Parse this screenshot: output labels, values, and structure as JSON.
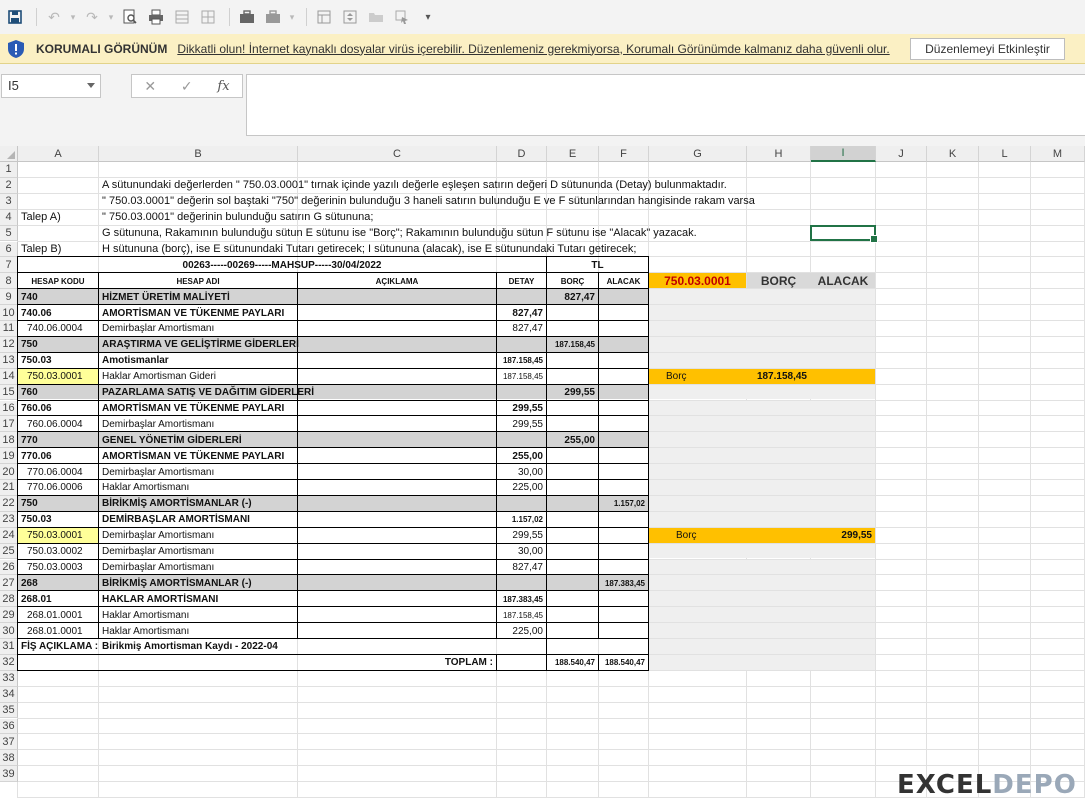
{
  "toolbar": {
    "icons": [
      "save-icon",
      "undo-icon",
      "redo-icon",
      "print-preview-icon",
      "print-icon",
      "sheet-icon",
      "sheet2-icon",
      "briefcase-icon",
      "briefcase2-icon",
      "table-icon",
      "sort-icon",
      "folder-icon",
      "cursor-icon",
      "customize-icon"
    ]
  },
  "protected_view": {
    "title": "KORUMALI GÖRÜNÜM",
    "message": "Dikkatli olun! İnternet kaynaklı dosyalar virüs içerebilir. Düzenlemeniz gerekmiyorsa, Korumalı Görünümde kalmanız daha güvenli olur.",
    "button": "Düzenlemeyi Etkinleştir",
    "bar_color": "#fbf0c4"
  },
  "formula_bar": {
    "name_box": "I5",
    "cancel": "✕",
    "enter": "✓",
    "fx": "fx",
    "value": ""
  },
  "columns": [
    "A",
    "B",
    "C",
    "D",
    "E",
    "F",
    "G",
    "H",
    "I",
    "J",
    "K",
    "L",
    "M"
  ],
  "rows": [
    "1",
    "2",
    "3",
    "4",
    "5",
    "6",
    "7",
    "8",
    "9",
    "10",
    "11",
    "12",
    "13",
    "14",
    "15",
    "16",
    "17",
    "18",
    "19",
    "20",
    "21",
    "22",
    "23",
    "24",
    "25",
    "26",
    "27",
    "28",
    "29",
    "30",
    "31",
    "32",
    "33",
    "34",
    "35",
    "36",
    "37",
    "38",
    "39"
  ],
  "notes": {
    "r2": "A sütunundaki değerlerden \"   750.03.0001\" tırnak içinde yazılı değerle eşleşen satırın değeri  D sütununda (Detay) bulunmaktadır.",
    "r3": "\"   750.03.0001\" değerin sol baştaki \"750\" değerinin bulunduğu 3 haneli satırın bulunduğu E ve F sütunlarından hangisinde rakam varsa",
    "r4a": "Talep A)",
    "r4b": "\"   750.03.0001\"  değerinin bulunduğu satırın G sütununa;",
    "r5": "G sütununa, Rakamının bulunduğu sütun E sütunu ise \"Borç\"; Rakamının bulunduğu sütun F sütunu ise \"Alacak\" yazacak.",
    "r6a": "Talep B)",
    "r6b": "H sütununa (borç), ise E sütunundaki Tutarı getirecek; I sütununa (alacak), ise E sütunundaki Tutarı getirecek;"
  },
  "voucher": {
    "header": "00263-----00269-----MAHSUP-----30/04/2022",
    "currency": "TL",
    "col_code": "HESAP KODU",
    "col_name": "HESAP ADI",
    "col_desc": "AÇIKLAMA",
    "col_detail": "DETAY",
    "col_debit": "BORÇ",
    "col_credit": "ALACAK",
    "rows": [
      {
        "code": "740",
        "name": "HİZMET ÜRETİM MALİYETİ",
        "detail": "",
        "debit": "827,47",
        "credit": "",
        "type": "group"
      },
      {
        "code": "740.06",
        "name": "AMORTİSMAN VE TÜKENME PAYLARI",
        "detail": "827,47",
        "debit": "",
        "credit": "",
        "type": "sub"
      },
      {
        "code": "740.06.0004",
        "name": "Demirbaşlar Amortismanı",
        "detail": "827,47",
        "debit": "",
        "credit": "",
        "type": "item"
      },
      {
        "code": "750",
        "name": "ARAŞTIRMA VE GELİŞTİRME GİDERLERİ",
        "detail": "",
        "debit": "187.158,45",
        "credit": "",
        "type": "group"
      },
      {
        "code": "750.03",
        "name": "Amotismanlar",
        "detail": "187.158,45",
        "debit": "",
        "credit": "",
        "type": "sub"
      },
      {
        "code": "750.03.0001",
        "name": "Haklar Amortisman Gideri",
        "detail": "187.158,45",
        "debit": "",
        "credit": "",
        "type": "item",
        "hl": true
      },
      {
        "code": "760",
        "name": "PAZARLAMA SATIŞ VE DAĞITIM GİDERLERİ",
        "detail": "",
        "debit": "299,55",
        "credit": "",
        "type": "group"
      },
      {
        "code": "760.06",
        "name": "AMORTİSMAN VE TÜKENME PAYLARI",
        "detail": "299,55",
        "debit": "",
        "credit": "",
        "type": "sub"
      },
      {
        "code": "760.06.0004",
        "name": "Demirbaşlar Amortismanı",
        "detail": "299,55",
        "debit": "",
        "credit": "",
        "type": "item"
      },
      {
        "code": "770",
        "name": "GENEL YÖNETİM GİDERLERİ",
        "detail": "",
        "debit": "255,00",
        "credit": "",
        "type": "group"
      },
      {
        "code": "770.06",
        "name": "AMORTİSMAN VE TÜKENME PAYLARI",
        "detail": "255,00",
        "debit": "",
        "credit": "",
        "type": "sub"
      },
      {
        "code": "770.06.0004",
        "name": "Demirbaşlar Amortismanı",
        "detail": "30,00",
        "debit": "",
        "credit": "",
        "type": "item"
      },
      {
        "code": "770.06.0006",
        "name": "Haklar Amortismanı",
        "detail": "225,00",
        "debit": "",
        "credit": "",
        "type": "item"
      },
      {
        "code": "750",
        "name": "BİRİKMİŞ AMORTİSMANLAR (-)",
        "detail": "",
        "debit": "",
        "credit": "1.157,02",
        "type": "group"
      },
      {
        "code": "750.03",
        "name": "DEMİRBAŞLAR AMORTİSMANI",
        "detail": "1.157,02",
        "debit": "",
        "credit": "",
        "type": "sub"
      },
      {
        "code": "750.03.0001",
        "name": "Demirbaşlar Amortismanı",
        "detail": "299,55",
        "debit": "",
        "credit": "",
        "type": "item",
        "hl": true
      },
      {
        "code": "750.03.0002",
        "name": "Demirbaşlar Amortismanı",
        "detail": "30,00",
        "debit": "",
        "credit": "",
        "type": "item"
      },
      {
        "code": "750.03.0003",
        "name": "Demirbaşlar Amortismanı",
        "detail": "827,47",
        "debit": "",
        "credit": "",
        "type": "item"
      },
      {
        "code": "268",
        "name": "BİRİKMİŞ AMORTİSMANLAR (-)",
        "detail": "",
        "debit": "",
        "credit": "187.383,45",
        "type": "group"
      },
      {
        "code": "268.01",
        "name": "HAKLAR AMORTİSMANI",
        "detail": "187.383,45",
        "debit": "",
        "credit": "",
        "type": "sub"
      },
      {
        "code": "268.01.0001",
        "name": "Haklar Amortismanı",
        "detail": "187.158,45",
        "debit": "",
        "credit": "",
        "type": "item"
      },
      {
        "code": "268.01.0001",
        "name": "Haklar Amortismanı",
        "detail": "225,00",
        "debit": "",
        "credit": "",
        "type": "item"
      }
    ],
    "fis_label": "FİŞ AÇIKLAMA :",
    "fis_value": "Birikmiş Amortisman Kaydı - 2022-04",
    "total_label": "TOPLAM :",
    "total_debit": "188.540,47",
    "total_credit": "188.540,47"
  },
  "result": {
    "header_key": "750.03.0001",
    "header_debit": "BORÇ",
    "header_credit": "ALACAK",
    "row14_label": "Borç",
    "row14_debit": "187.158,45",
    "row24_label": "Borç",
    "row24_credit": "299,55"
  },
  "watermark": {
    "brand_a": "EXCEL",
    "brand_b": "DEPO"
  },
  "colors": {
    "group_fill": "#d3d3d3",
    "highlight_yellow": "#ffff99",
    "orange": "#ffc000",
    "result_header_fill": "#d9d9d9",
    "result_area_fill": "#efefef",
    "selection": "#217346"
  }
}
